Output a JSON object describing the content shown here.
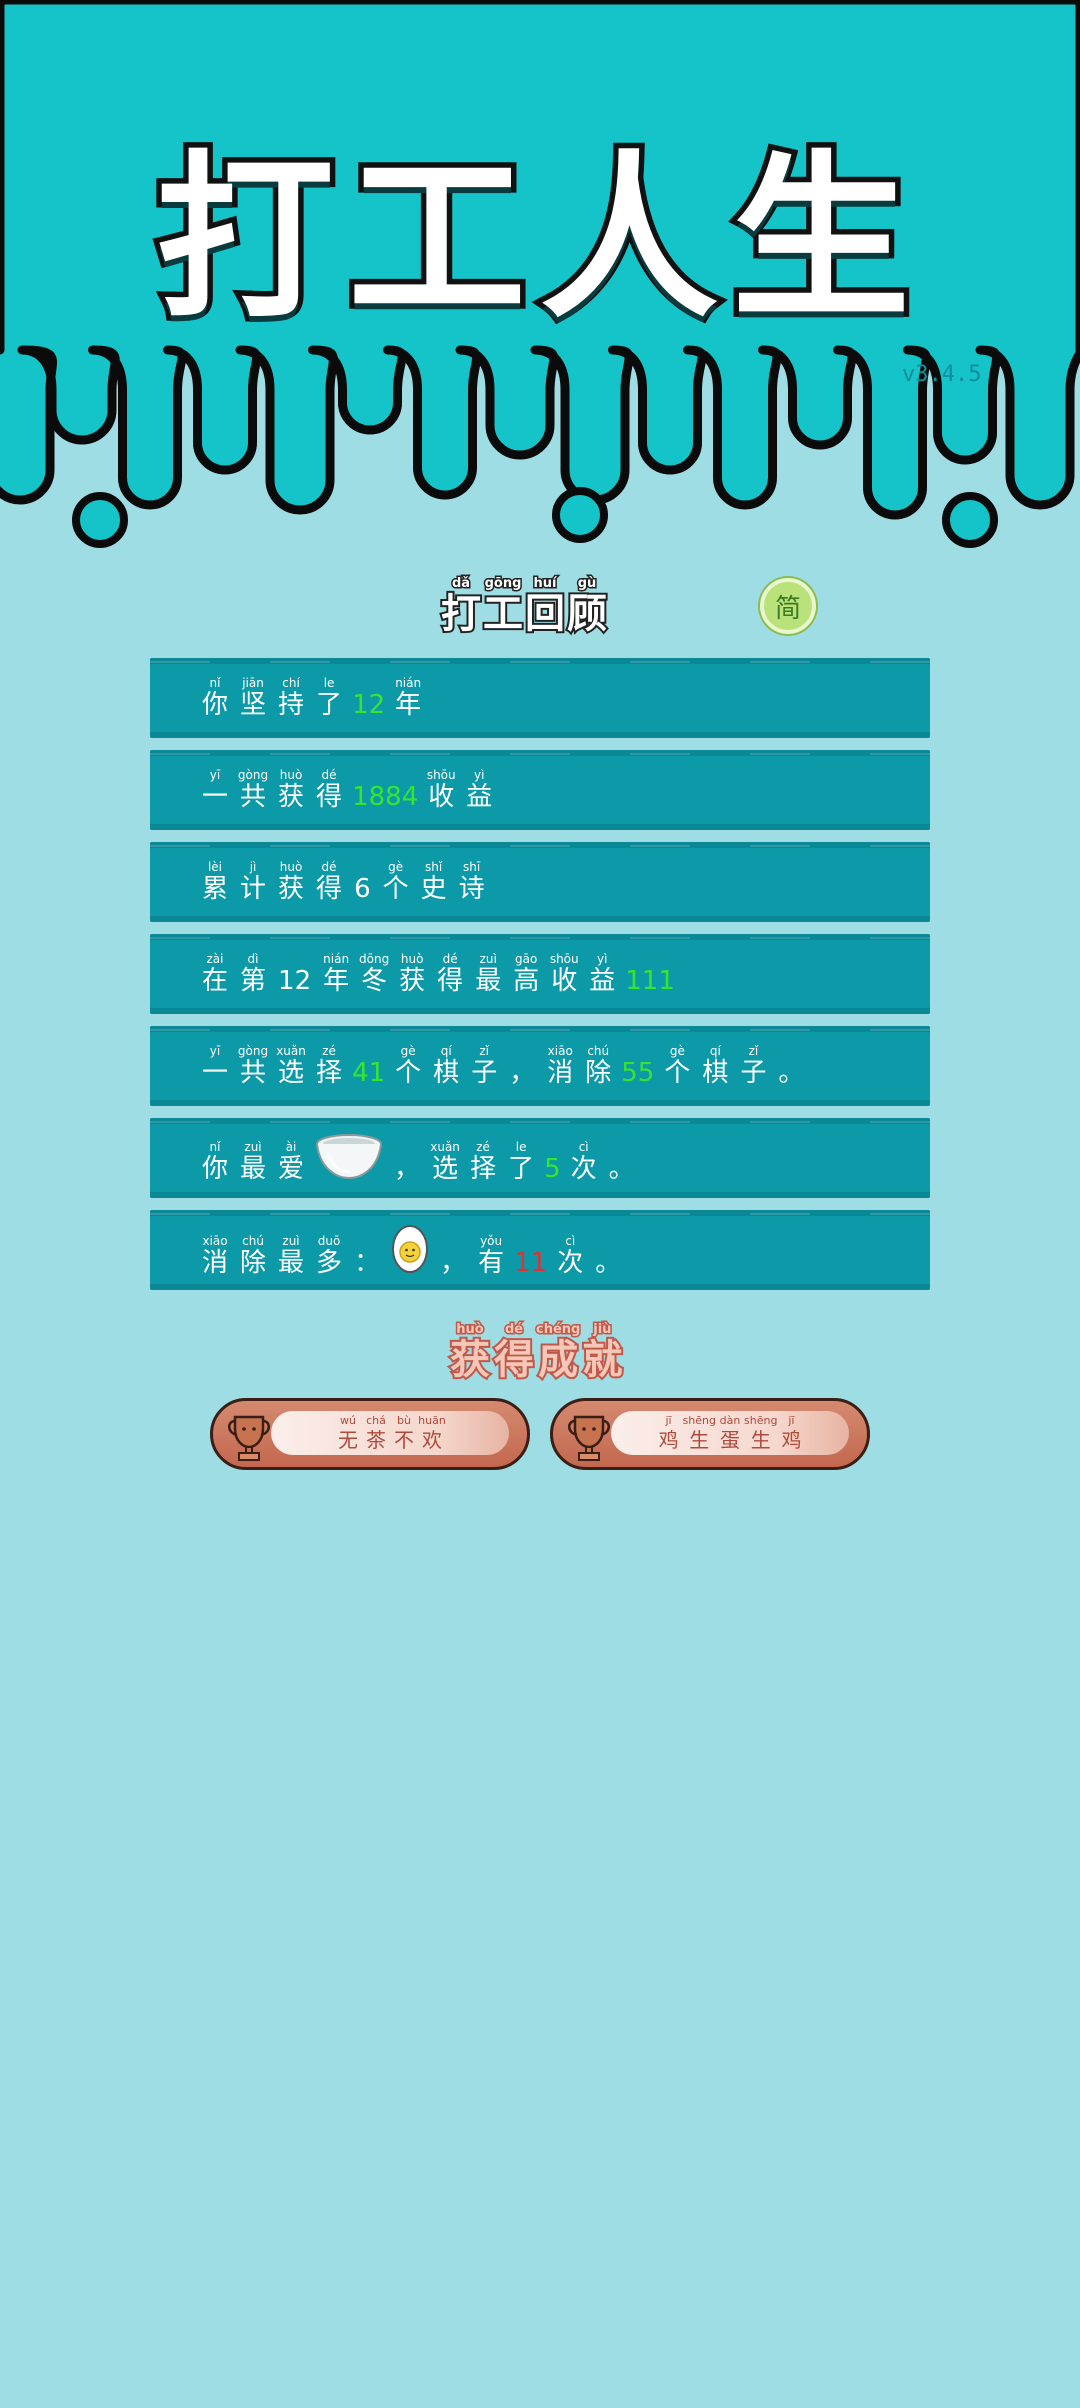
{
  "game_title": "打工人生",
  "version": "v3.4.5",
  "review_heading": [
    {
      "hz": "打",
      "py": "dǎ"
    },
    {
      "hz": "工",
      "py": "gōng"
    },
    {
      "hz": "回",
      "py": "huí"
    },
    {
      "hz": "顾",
      "py": "gù"
    }
  ],
  "simplified_button": "简",
  "stats": [
    {
      "parts": [
        {
          "hz": "你",
          "py": "nǐ"
        },
        {
          "hz": "坚",
          "py": "jiān"
        },
        {
          "hz": "持",
          "py": "chí"
        },
        {
          "hz": "了",
          "py": "le"
        },
        {
          "hl": "12"
        },
        {
          "hz": "年",
          "py": "nián"
        }
      ]
    },
    {
      "parts": [
        {
          "hz": "一",
          "py": "yī"
        },
        {
          "hz": "共",
          "py": "gòng"
        },
        {
          "hz": "获",
          "py": "huò"
        },
        {
          "hz": "得",
          "py": "dé"
        },
        {
          "hl": "1884"
        },
        {
          "hz": "收",
          "py": "shōu"
        },
        {
          "hz": "益",
          "py": "yì"
        }
      ]
    },
    {
      "parts": [
        {
          "hz": "累",
          "py": "lèi"
        },
        {
          "hz": "计",
          "py": "jì"
        },
        {
          "hz": "获",
          "py": "huò"
        },
        {
          "hz": "得",
          "py": "dé"
        },
        {
          "punct": "6"
        },
        {
          "hz": "个",
          "py": "gè"
        },
        {
          "hz": "史",
          "py": "shǐ"
        },
        {
          "hz": "诗",
          "py": "shī"
        }
      ]
    },
    {
      "parts": [
        {
          "hz": "在",
          "py": "zài"
        },
        {
          "hz": "第",
          "py": "dì"
        },
        {
          "punct": "12"
        },
        {
          "hz": "年",
          "py": "nián"
        },
        {
          "hz": "冬",
          "py": "dōng"
        },
        {
          "hz": "获",
          "py": "huò"
        },
        {
          "hz": "得",
          "py": "dé"
        },
        {
          "hz": "最",
          "py": "zuì"
        },
        {
          "hz": "高",
          "py": "gāo"
        },
        {
          "hz": "收",
          "py": "shōu"
        },
        {
          "hz": "益",
          "py": "yì"
        },
        {
          "hl": "111"
        }
      ]
    },
    {
      "parts": [
        {
          "hz": "一",
          "py": "yī"
        },
        {
          "hz": "共",
          "py": "gòng"
        },
        {
          "hz": "选",
          "py": "xuǎn"
        },
        {
          "hz": "择",
          "py": "zé"
        },
        {
          "hl": "41"
        },
        {
          "hz": "个",
          "py": "gè"
        },
        {
          "hz": "棋",
          "py": "qí"
        },
        {
          "hz": "子",
          "py": "zǐ"
        },
        {
          "punct": "，"
        },
        {
          "hz": "消",
          "py": "xiāo"
        },
        {
          "hz": "除",
          "py": "chú"
        },
        {
          "hl": "55"
        },
        {
          "hz": "个",
          "py": "gè"
        },
        {
          "hz": "棋",
          "py": "qí"
        },
        {
          "hz": "子",
          "py": "zǐ"
        },
        {
          "punct": "。"
        }
      ]
    },
    {
      "parts": [
        {
          "hz": "你",
          "py": "nǐ"
        },
        {
          "hz": "最",
          "py": "zuì"
        },
        {
          "hz": "爱",
          "py": "ài"
        },
        {
          "icon": "bowl-icon"
        },
        {
          "punct": "，"
        },
        {
          "hz": "选",
          "py": "xuǎn"
        },
        {
          "hz": "择",
          "py": "zé"
        },
        {
          "hz": "了",
          "py": "le"
        },
        {
          "hl": "5"
        },
        {
          "hz": "次",
          "py": "cì"
        },
        {
          "punct": "。"
        }
      ]
    },
    {
      "parts": [
        {
          "hz": "消",
          "py": "xiāo"
        },
        {
          "hz": "除",
          "py": "chú"
        },
        {
          "hz": "最",
          "py": "zuì"
        },
        {
          "hz": "多",
          "py": "duō"
        },
        {
          "punct": "："
        },
        {
          "icon": "egg-icon"
        },
        {
          "punct": "，"
        },
        {
          "hz": "有",
          "py": "yǒu"
        },
        {
          "hlred": "11"
        },
        {
          "hz": "次",
          "py": "cì"
        },
        {
          "punct": "。"
        }
      ]
    }
  ],
  "achievements_heading": [
    {
      "hz": "获",
      "py": "huò"
    },
    {
      "hz": "得",
      "py": "dé"
    },
    {
      "hz": "成",
      "py": "chéng"
    },
    {
      "hz": "就",
      "py": "jiù"
    }
  ],
  "achievements": [
    {
      "chars": [
        {
          "hz": "无",
          "py": "wú"
        },
        {
          "hz": "茶",
          "py": "chá"
        },
        {
          "hz": "不",
          "py": "bù"
        },
        {
          "hz": "欢",
          "py": "huān"
        }
      ]
    },
    {
      "chars": [
        {
          "hz": "鸡",
          "py": "jī"
        },
        {
          "hz": "生",
          "py": "shēng"
        },
        {
          "hz": "蛋",
          "py": "dàn"
        },
        {
          "hz": "生",
          "py": "shēng"
        },
        {
          "hz": "鸡",
          "py": "jī"
        }
      ]
    }
  ],
  "colors": {
    "background": "#9fdde4",
    "header": "#14c4c8",
    "panel": "#0d9aa8",
    "highlight": "#35e62f",
    "highlight_red": "#e03232"
  }
}
